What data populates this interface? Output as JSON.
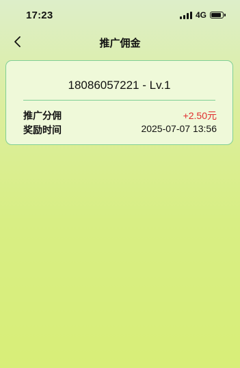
{
  "status_bar": {
    "time": "17:23",
    "network": "4G",
    "battery_level": 0.9
  },
  "nav": {
    "title": "推广佣金",
    "back_icon": "chevron-left-icon"
  },
  "record": {
    "phone_level": "18086057221 - Lv.1",
    "commission_label": "推广分佣",
    "commission_value": "+2.50元",
    "time_label": "奖励时间",
    "time_value": "2025-07-07 13:56"
  },
  "colors": {
    "amount": "#e02d2d",
    "card_border": "#7fcf95",
    "card_bg": "#eff9d9"
  }
}
